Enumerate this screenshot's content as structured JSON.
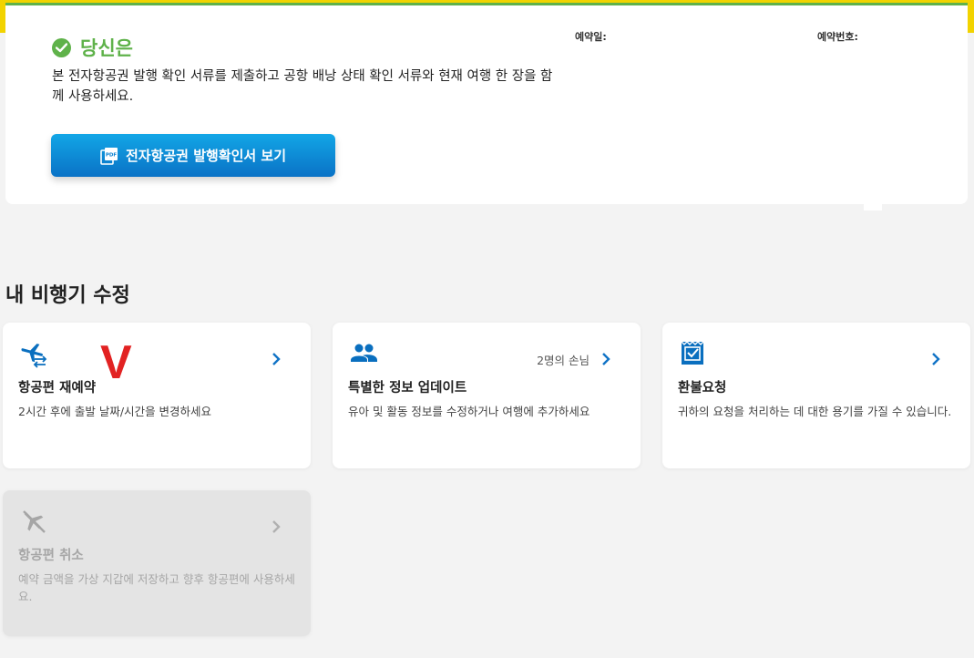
{
  "confirmation": {
    "title": "당신은",
    "description": "본 전자항공권 발행 확인 서류를 제출하고 공항 배낭 상태 확인 서류와 현재 여행 한 장을 함께 사용하세요.",
    "booking_date_label": "예약일:",
    "booking_number_label": "예약번호:",
    "pdf_button_label": "전자항공권 발행확인서 보기",
    "accent_color": "#5fb24a"
  },
  "section": {
    "title": "내 비행기 수정"
  },
  "cards": [
    {
      "icon": "flight-change-icon",
      "title": "항공편 재예약",
      "description": "2시간 후에 출발 날짜/시간을 변경하세요",
      "annotation": "V",
      "annotation_color": "#e22222"
    },
    {
      "icon": "people-icon",
      "title": "특별한 정보 업데이트",
      "description": "유아 및 활동 정보를 수정하거나 여행에 추가하세요",
      "count": "2명의 손님"
    },
    {
      "icon": "refund-receipt-icon",
      "title": "환불요청",
      "description": "귀하의 요청을 처리하는 데 대한 용기를 가질 수 있습니다."
    },
    {
      "icon": "flight-cancel-icon",
      "title": "항공편 취소",
      "description": "예약 금액을 가상 지갑에 저장하고 향후 항공편에 사용하세요.",
      "disabled": true
    }
  ],
  "colors": {
    "primary_blue": "#0a72c6",
    "chevron_blue": "#1173c6",
    "disabled_gray": "#a6a6a6",
    "top_band_yellow": "#f2d300"
  }
}
